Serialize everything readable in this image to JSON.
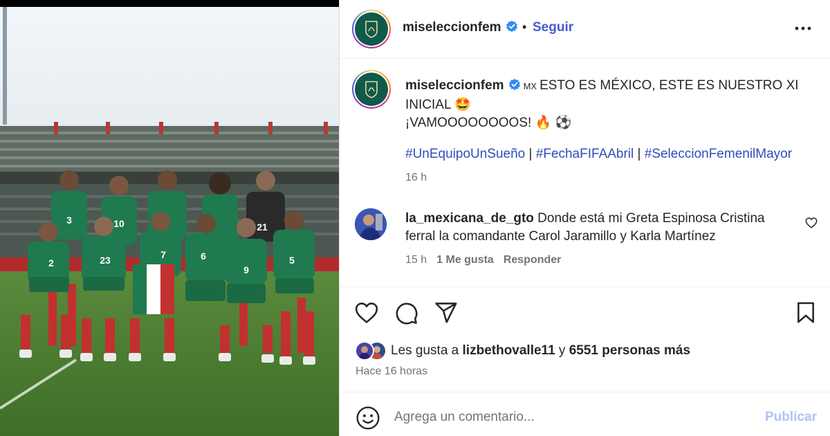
{
  "post": {
    "username": "miseleccionfem",
    "follow_label": "Seguir",
    "dot": "•",
    "caption_flag": "MX",
    "caption_line1": "ESTO ES MÉXICO, ESTE ES NUESTRO XI INICIAL 🤩",
    "caption_line2": "¡VAMOOOOOOOOS! 🔥 ⚽",
    "hashtags": [
      "#UnEquipoUnSueño",
      "#FechaFIFAAbril",
      "#SeleccionFemenilMayor"
    ],
    "hashtag_sep": " | ",
    "caption_time": "16 h"
  },
  "photo": {
    "jersey_numbers": [
      "3",
      "10",
      "21",
      "2",
      "23",
      "7",
      "6",
      "9",
      "5"
    ]
  },
  "comment": {
    "username": "la_mexicana_de_gto",
    "text": "Donde está mi Greta Espinosa Cristina ferral la comandante Carol Jaramillo y Karla Martínez",
    "time": "15 h",
    "likes": "1 Me gusta",
    "reply": "Responder"
  },
  "likes": {
    "prefix": "Les gusta a ",
    "user": "lizbethovalle11",
    "middle": " y ",
    "others": "6551 personas más"
  },
  "posted_ago": "Hace 16 horas",
  "composer": {
    "placeholder": "Agrega un comentario...",
    "publish_label": "Publicar"
  },
  "colors": {
    "link": "#2e4eb8",
    "follow": "#4a5bd1",
    "publish_disabled": "#b3c1f3",
    "jersey_green": "#1f7a4f",
    "crest_green": "#0f5a4b"
  }
}
